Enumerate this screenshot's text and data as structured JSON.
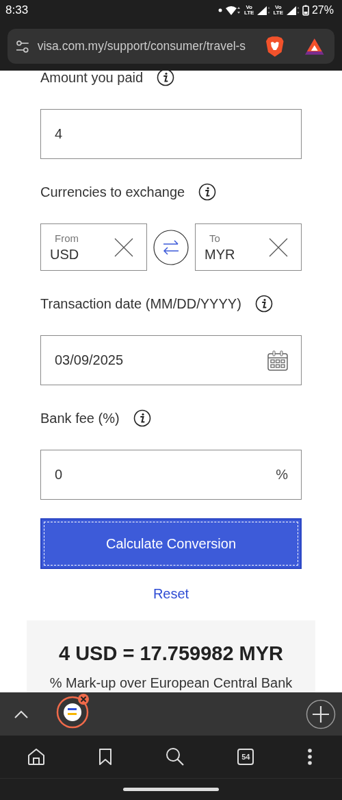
{
  "status_bar": {
    "time": "8:33",
    "battery": "27%",
    "networks": [
      {
        "top": "Vo",
        "bottom": "LTE"
      },
      {
        "top": "Vo",
        "bottom": "LTE"
      }
    ]
  },
  "address_bar": {
    "url": "visa.com.my/support/consumer/travel-s"
  },
  "form": [
    {
      "kind": "text",
      "label": "Amount you paid",
      "value": "4"
    },
    {
      "kind": "currency_pair",
      "label": "Currencies to exchange",
      "from": {
        "caption": "From",
        "value": "USD"
      },
      "to": {
        "caption": "To",
        "value": "MYR"
      }
    },
    {
      "kind": "date",
      "label": "Transaction date (MM/DD/YYYY)",
      "value": "03/09/2025"
    },
    {
      "kind": "text",
      "label": "Bank fee (%)",
      "value": "0",
      "suffix": "%"
    }
  ],
  "calculate_button": {
    "label": "Calculate Conversion",
    "focused": true
  },
  "reset_link": "Reset",
  "result": {
    "heading": "4 USD = 17.759982 MYR",
    "note": "% Mark-up over European Central Bank"
  },
  "tab_strip": {
    "tab_count": "54"
  }
}
